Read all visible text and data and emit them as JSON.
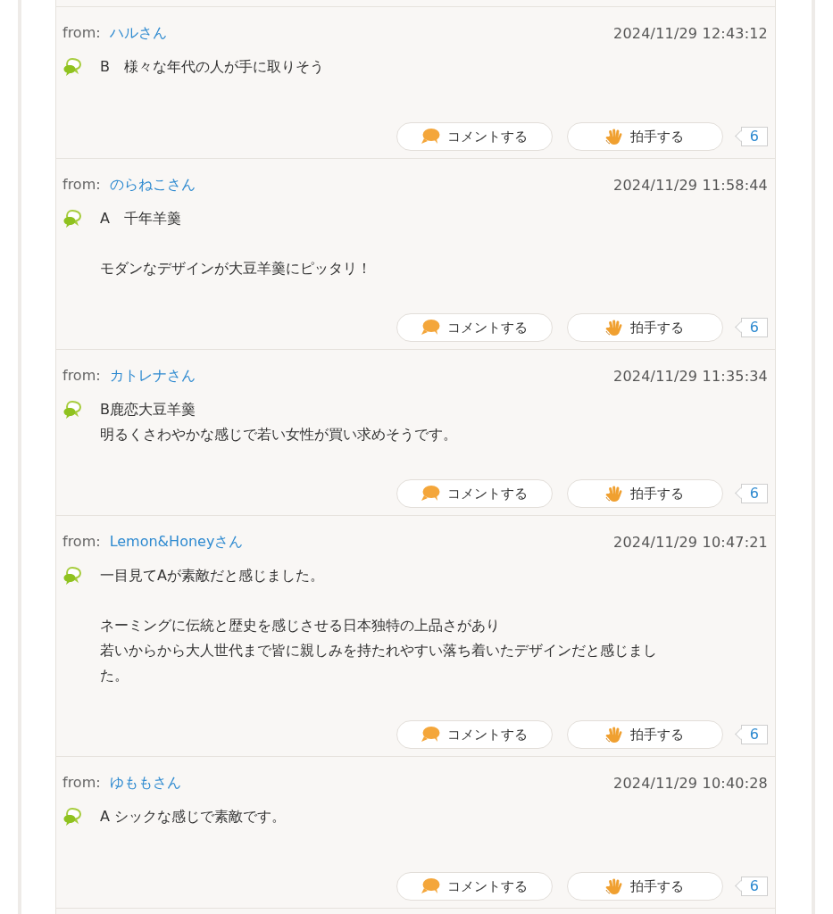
{
  "comments": [
    {
      "from_label": "from:",
      "author": "ハルさん",
      "date": "2024/11/29 12:43:12",
      "paragraphs": [
        [
          "B　様々な年代の人が手に取りそう"
        ]
      ],
      "comment_button": "コメントする",
      "clap_button": "拍手する",
      "clap_count": "6"
    },
    {
      "from_label": "from:",
      "author": "のらねこさん",
      "date": "2024/11/29 11:58:44",
      "paragraphs": [
        [
          "A　千年羊羹"
        ],
        [
          "モダンなデザインが大豆羊羹にピッタリ！"
        ]
      ],
      "comment_button": "コメントする",
      "clap_button": "拍手する",
      "clap_count": "6"
    },
    {
      "from_label": "from:",
      "author": "カトレナさん",
      "date": "2024/11/29 11:35:34",
      "paragraphs": [
        [
          "B鹿恋大豆羊羹",
          "明るくさわやかな感じで若い女性が買い求めそうです。"
        ]
      ],
      "comment_button": "コメントする",
      "clap_button": "拍手する",
      "clap_count": "6"
    },
    {
      "from_label": "from:",
      "author": "Lemon&Honeyさん",
      "date": "2024/11/29 10:47:21",
      "paragraphs": [
        [
          "一目見てAが素敵だと感じました。"
        ],
        [
          "ネーミングに伝統と歴史を感じさせる日本独特の上品さがあり",
          "若いからから大人世代まで皆に親しみを持たれやすい落ち着いたデザインだと感じました。"
        ]
      ],
      "comment_button": "コメントする",
      "clap_button": "拍手する",
      "clap_count": "6"
    },
    {
      "from_label": "from:",
      "author": "ゆももさん",
      "date": "2024/11/29 10:40:28",
      "paragraphs": [
        [
          "A シックな感じで素敵です。"
        ]
      ],
      "comment_button": "コメントする",
      "clap_button": "拍手する",
      "clap_count": "6"
    }
  ]
}
